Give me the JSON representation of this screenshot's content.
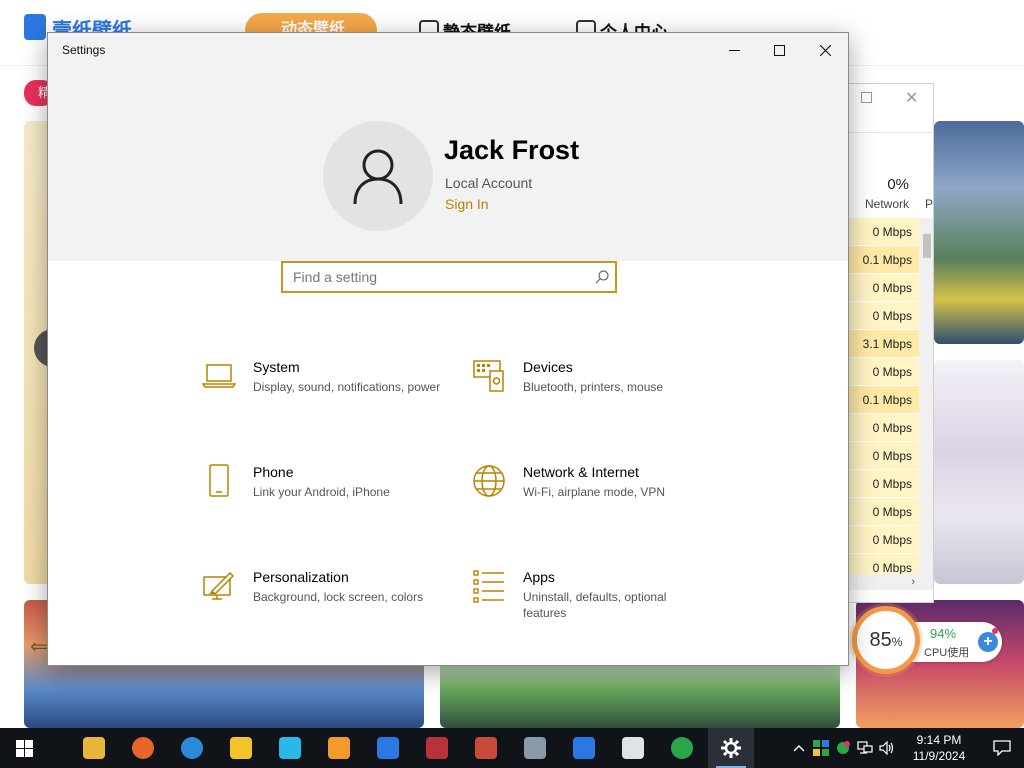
{
  "background_app": {
    "logo_text": "壹纸壁纸",
    "tabs": [
      {
        "label": "动态壁纸",
        "active": true
      },
      {
        "label": "静态壁纸",
        "active": false
      },
      {
        "label": "个人中心",
        "active": false
      }
    ],
    "badge": "精"
  },
  "task_manager": {
    "cpu_percent": "0%",
    "column_header": "Network",
    "next_column_header": "P",
    "network_values": [
      "0 Mbps",
      "0.1 Mbps",
      "0 Mbps",
      "0 Mbps",
      "3.1 Mbps",
      "0 Mbps",
      "0.1 Mbps",
      "0 Mbps",
      "0 Mbps",
      "0 Mbps",
      "0 Mbps",
      "0 Mbps",
      "0 Mbps"
    ]
  },
  "cpu_widget": {
    "main_value": "85",
    "main_unit": "%",
    "secondary_value": "94%",
    "label": "CPU使用"
  },
  "settings": {
    "window_title": "Settings",
    "user": {
      "name": "Jack Frost",
      "account_type": "Local Account",
      "sign_in_label": "Sign In"
    },
    "search": {
      "placeholder": "Find a setting",
      "value": ""
    },
    "categories": [
      {
        "title": "System",
        "description": "Display, sound, notifications, power",
        "icon": "laptop-icon"
      },
      {
        "title": "Devices",
        "description": "Bluetooth, printers, mouse",
        "icon": "devices-icon"
      },
      {
        "title": "Phone",
        "description": "Link your Android, iPhone",
        "icon": "phone-icon"
      },
      {
        "title": "Network & Internet",
        "description": "Wi-Fi, airplane mode, VPN",
        "icon": "globe-icon"
      },
      {
        "title": "Personalization",
        "description": "Background, lock screen, colors",
        "icon": "paintbrush-icon"
      },
      {
        "title": "Apps",
        "description": "Uninstall, defaults, optional features",
        "icon": "apps-list-icon"
      }
    ],
    "accent_color": "#c9971c"
  },
  "taskbar": {
    "pinned_apps": [
      {
        "name": "file-explorer-icon",
        "color": "#e8b73a"
      },
      {
        "name": "firefox-icon",
        "color": "#e8642a"
      },
      {
        "name": "edge-icon",
        "color": "#2b8ad9"
      },
      {
        "name": "gallery-app-icon",
        "color": "#f2c42a"
      },
      {
        "name": "paint-app-icon",
        "color": "#2ab8e8"
      },
      {
        "name": "office-app-icon",
        "color": "#f29a2a"
      },
      {
        "name": "wallpaper-app-icon",
        "color": "#2b78e4"
      },
      {
        "name": "winrar-icon",
        "color": "#b8323a"
      },
      {
        "name": "winrar-alt-icon",
        "color": "#c84a3a"
      },
      {
        "name": "remote-desktop-icon",
        "color": "#8a9aa8"
      },
      {
        "name": "security-shield-icon",
        "color": "#2b78e4"
      },
      {
        "name": "people-icon",
        "color": "#dfe3e8"
      },
      {
        "name": "green-plus-icon",
        "color": "#2aa64a"
      },
      {
        "name": "settings-gear-icon",
        "color": "#ffffff"
      }
    ],
    "clock_time": "9:14 PM",
    "clock_date": "11/9/2024"
  }
}
